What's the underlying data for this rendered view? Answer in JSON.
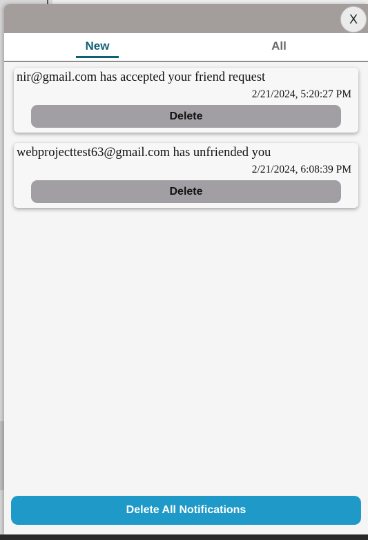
{
  "header": {
    "close_label": "X"
  },
  "tabs": [
    {
      "label": "New",
      "active": true
    },
    {
      "label": "All",
      "active": false
    }
  ],
  "notifications": [
    {
      "message": "nir@gmail.com has accepted your friend request",
      "timestamp": "2/21/2024, 5:20:27 PM",
      "delete_label": "Delete"
    },
    {
      "message": "webprojecttest63@gmail.com has unfriended you",
      "timestamp": "2/21/2024, 6:08:39 PM",
      "delete_label": "Delete"
    }
  ],
  "footer": {
    "delete_all_label": "Delete All Notifications"
  },
  "colors": {
    "header_bg": "#a39e9b",
    "active_tab": "#0f5f78",
    "delete_button": "#a19fa3",
    "primary_button": "#1f9ac8",
    "panel_bg": "#f5f5f5"
  }
}
